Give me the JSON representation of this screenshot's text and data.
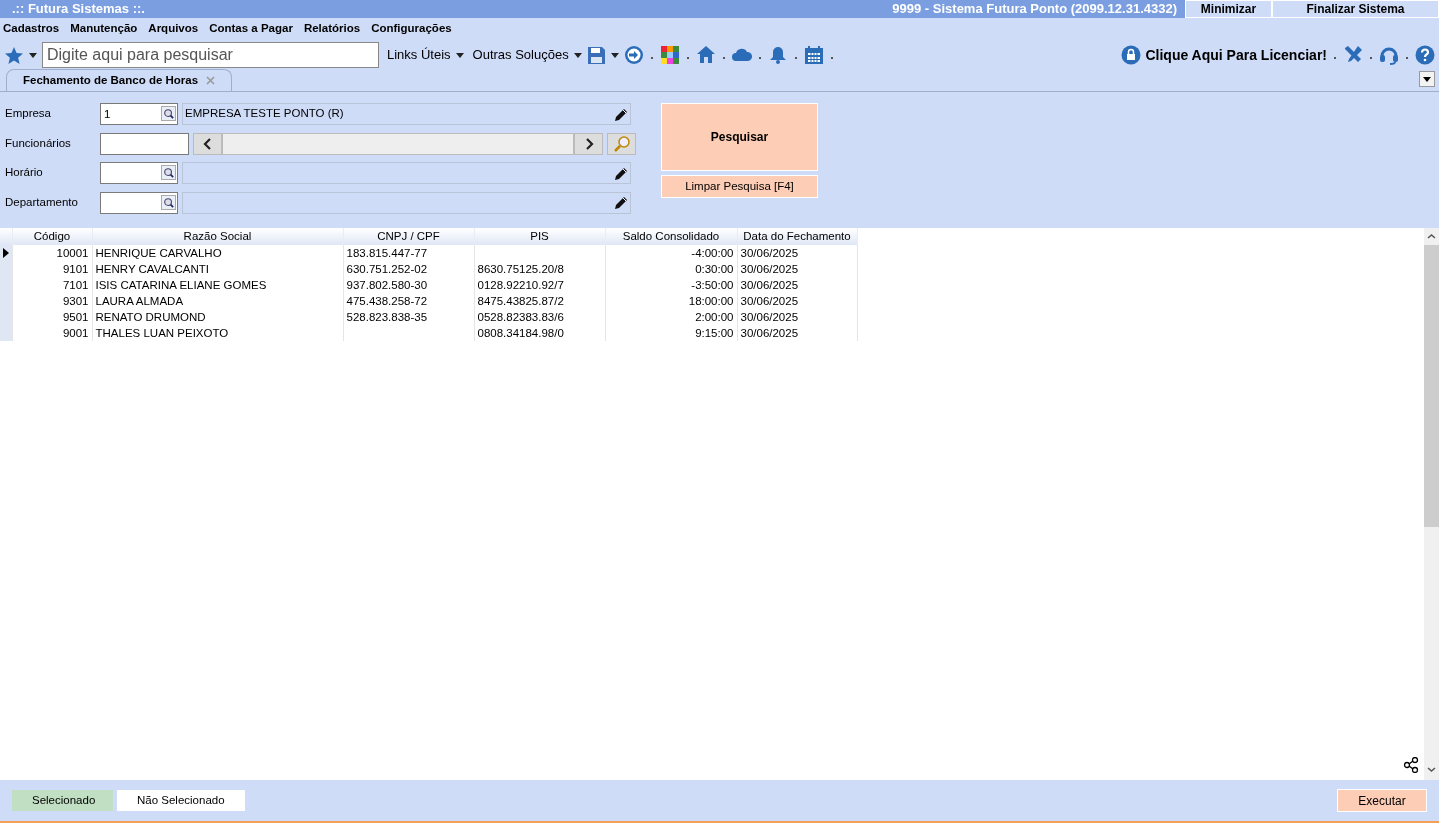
{
  "window": {
    "app_title": ".:: Futura Sistemas ::.",
    "system_title": "9999 - Sistema Futura Ponto (2099.12.31.4332)",
    "buttons": [
      "Minimizar",
      "Finalizar Sistema"
    ]
  },
  "menu": [
    "Cadastros",
    "Manutenção",
    "Arquivos",
    "Contas a Pagar",
    "Relatórios",
    "Configurações"
  ],
  "toolbar": {
    "search": {
      "placeholder": "Digite aqui para pesquisar"
    },
    "links": [
      "Links Úteis",
      "Outras Soluções"
    ],
    "license": "Clique Aqui Para Licenciar!"
  },
  "tabs": [
    {
      "label": "Fechamento de Banco de Horas",
      "selected": true
    }
  ],
  "form": {
    "fields": [
      {
        "kind": "lookup",
        "label": "Empresa",
        "value": "1",
        "description": "EMPRESA TESTE PONTO (R)"
      },
      {
        "kind": "navigator",
        "label": "Funcionários"
      },
      {
        "kind": "lookup",
        "label": "Horário"
      },
      {
        "kind": "lookup",
        "label": "Departamento"
      }
    ],
    "buttons": [
      {
        "kind": "primary",
        "label": "Pesquisar"
      },
      {
        "kind": "secondary",
        "label": "Limpar Pesquisa [F4]"
      }
    ]
  },
  "table": {
    "columns": [
      "Código",
      "Razão Social",
      "CNPJ / CPF",
      "PIS",
      "Saldo Consolidado",
      "Data do Fechamento"
    ],
    "rows": [
      {
        "current": true,
        "cells": [
          "10001",
          "HENRIQUE CARVALHO",
          "183.815.447-77",
          "",
          "-4:00:00",
          "30/06/2025"
        ]
      },
      {
        "current": false,
        "cells": [
          "9101",
          "HENRY CAVALCANTI",
          "630.751.252-02",
          "8630.75125.20/8",
          "0:30:00",
          "30/06/2025"
        ]
      },
      {
        "current": false,
        "cells": [
          "7101",
          "ISIS CATARINA ELIANE GOMES",
          "937.802.580-30",
          "0128.92210.92/7",
          "-3:50:00",
          "30/06/2025"
        ]
      },
      {
        "current": false,
        "cells": [
          "9301",
          "LAURA ALMADA",
          "475.438.258-72",
          "8475.43825.87/2",
          "18:00:00",
          "30/06/2025"
        ]
      },
      {
        "current": false,
        "cells": [
          "9501",
          "RENATO DRUMOND",
          "528.823.838-35",
          "0528.82383.83/6",
          "2:00:00",
          "30/06/2025"
        ]
      },
      {
        "current": false,
        "cells": [
          "9001",
          "THALES LUAN PEIXOTO",
          "",
          "0808.34184.98/0",
          "9:15:00",
          "30/06/2025"
        ]
      }
    ]
  },
  "legend": [
    {
      "label": "Selecionado",
      "color": "#c1dfc3"
    },
    {
      "label": "Não Selecionado",
      "color": "#ffffff"
    }
  ],
  "action": "Executar"
}
